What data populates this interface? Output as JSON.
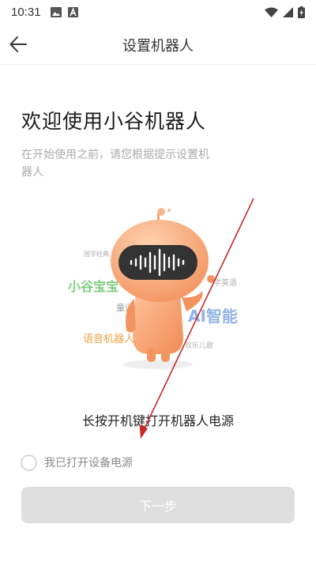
{
  "status_bar": {
    "time": "10:31",
    "icons": [
      "image-icon",
      "a-icon",
      "wifi-icon",
      "signal-icon",
      "battery-charging-icon"
    ]
  },
  "app_bar": {
    "back_icon": "arrow-left-icon",
    "title": "设置机器人"
  },
  "welcome": {
    "title": "欢迎使用小谷机器人",
    "subtitle": "在开始使用之前，请您根据提示设置机器人"
  },
  "illustration": {
    "tags": {
      "guoxue": "国学经典",
      "xiaogu": "小谷宝宝",
      "english": "学英语",
      "story": "童话故事",
      "ai": "AI智能",
      "voice_robot": "语音机器人",
      "songs": "欢乐儿歌"
    },
    "colors": {
      "robot_body": "#f7a36d",
      "visor": "#333333",
      "xiaogu_tag": "#7ecf7e",
      "ai_tag": "#8fb4e6",
      "voice_tag": "#f0a040"
    }
  },
  "instruction": "长按开机键打开机器人电源",
  "confirm": {
    "label": "我已打开设备电源",
    "checked": false
  },
  "next_button": {
    "label": "下一步",
    "enabled": false
  },
  "annotation": {
    "color": "#c62828"
  }
}
